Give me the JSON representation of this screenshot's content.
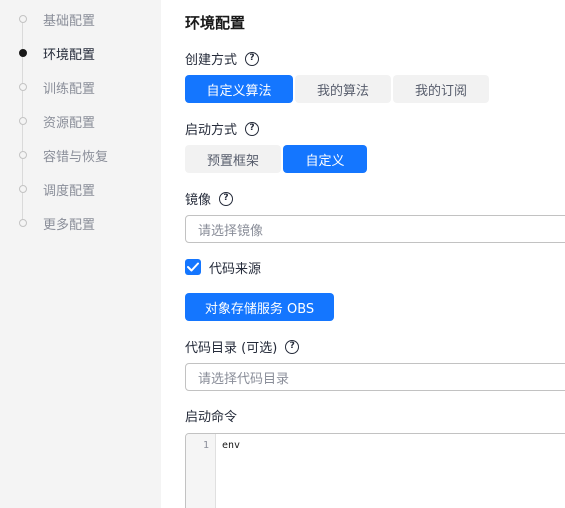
{
  "sidebar": {
    "steps": [
      {
        "label": "基础配置",
        "active": false
      },
      {
        "label": "环境配置",
        "active": true
      },
      {
        "label": "训练配置",
        "active": false
      },
      {
        "label": "资源配置",
        "active": false
      },
      {
        "label": "容错与恢复",
        "active": false
      },
      {
        "label": "调度配置",
        "active": false
      },
      {
        "label": "更多配置",
        "active": false
      }
    ]
  },
  "main": {
    "title": "环境配置",
    "creation_method": {
      "label": "创建方式",
      "options": [
        "自定义算法",
        "我的算法",
        "我的订阅"
      ],
      "selected": "自定义算法"
    },
    "boot_method": {
      "label": "启动方式",
      "options": [
        "预置框架",
        "自定义"
      ],
      "selected": "自定义"
    },
    "image": {
      "label": "镜像",
      "placeholder": "请选择镜像"
    },
    "code_source": {
      "label": "代码来源",
      "checked": true,
      "button": "对象存储服务 OBS"
    },
    "code_dir": {
      "label": "代码目录 (可选)",
      "placeholder": "请选择代码目录"
    },
    "boot_command": {
      "label": "启动命令",
      "line_number": "1",
      "code": "env"
    }
  },
  "help_glyph": "?",
  "colors": {
    "primary": "#1476ff",
    "sidebar_bg": "#f4f4f4",
    "segment_bg": "#f2f2f2"
  }
}
